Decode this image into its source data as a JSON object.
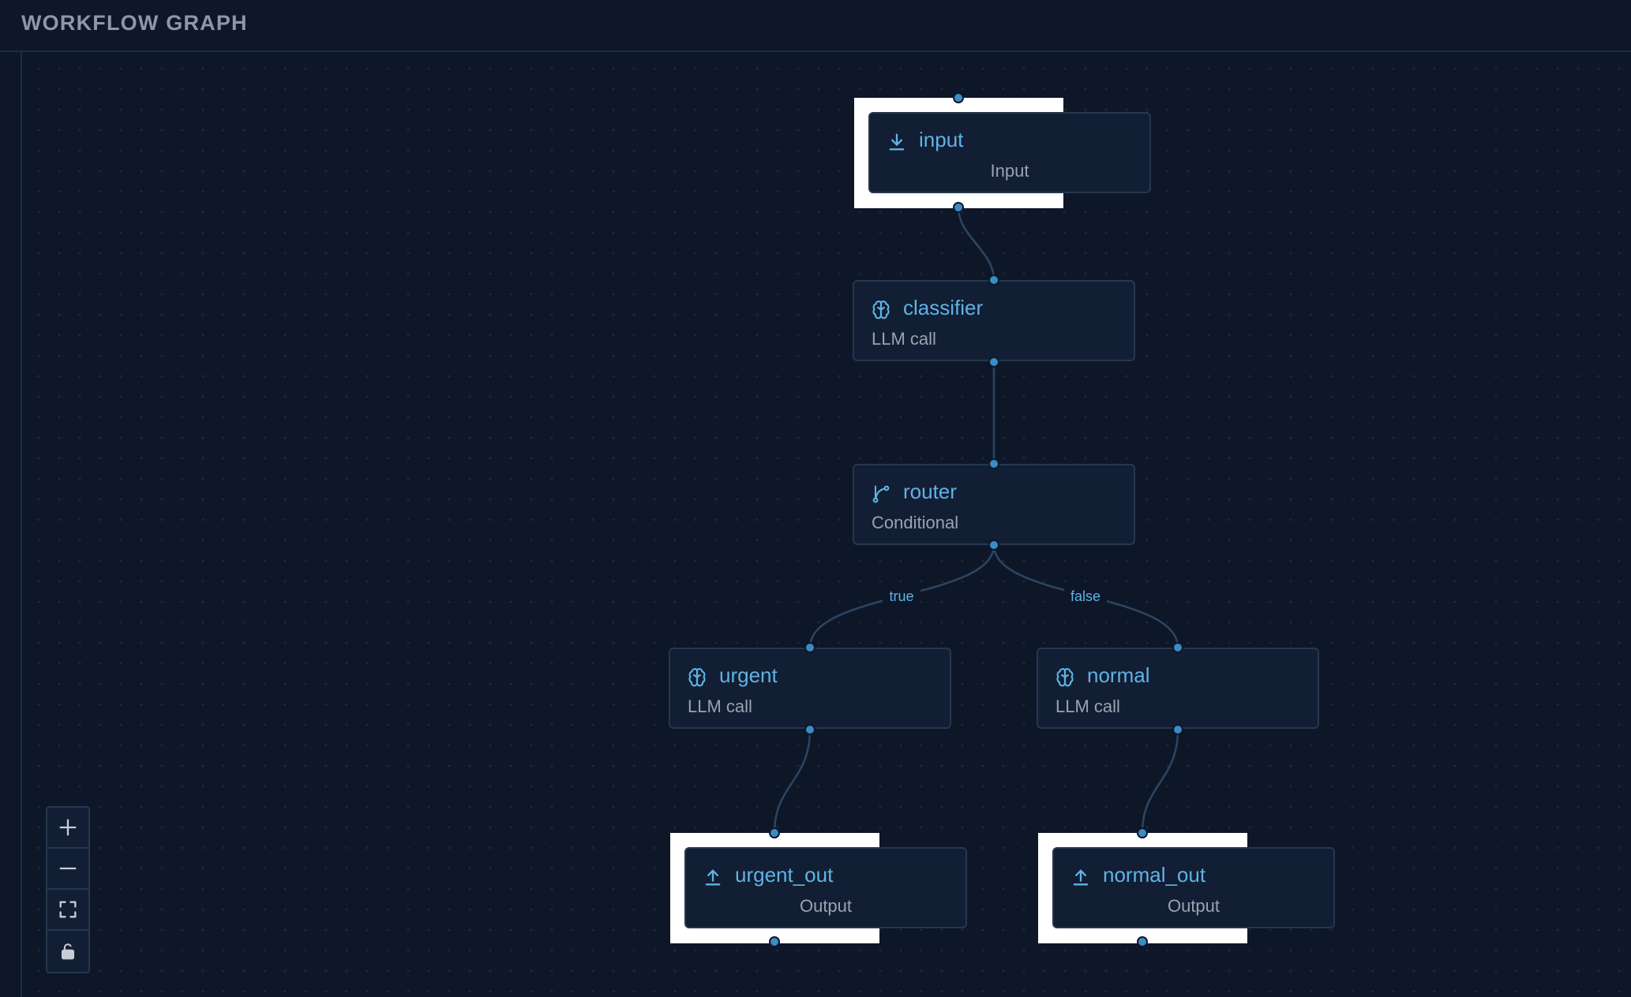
{
  "panel": {
    "title": "WORKFLOW GRAPH"
  },
  "nodes": {
    "input": {
      "name": "input",
      "type": "Input",
      "icon": "download-icon"
    },
    "classifier": {
      "name": "classifier",
      "type": "LLM call",
      "icon": "brain-icon"
    },
    "router": {
      "name": "router",
      "type": "Conditional",
      "icon": "branch-icon"
    },
    "urgent": {
      "name": "urgent",
      "type": "LLM call",
      "icon": "brain-icon"
    },
    "normal": {
      "name": "normal",
      "type": "LLM call",
      "icon": "brain-icon"
    },
    "urgent_out": {
      "name": "urgent_out",
      "type": "Output",
      "icon": "upload-icon"
    },
    "normal_out": {
      "name": "normal_out",
      "type": "Output",
      "icon": "upload-icon"
    }
  },
  "edges": {
    "router_true": "true",
    "router_false": "false"
  },
  "controls": [
    "zoom-in-icon",
    "zoom-out-icon",
    "fit-view-icon",
    "lock-icon"
  ],
  "colors": {
    "background": "#0d1728",
    "node_bg": "#121e33",
    "node_border": "#26374f",
    "accent": "#5fb3e6",
    "edge": "#2b4562",
    "muted_text": "#9aa3b0"
  }
}
